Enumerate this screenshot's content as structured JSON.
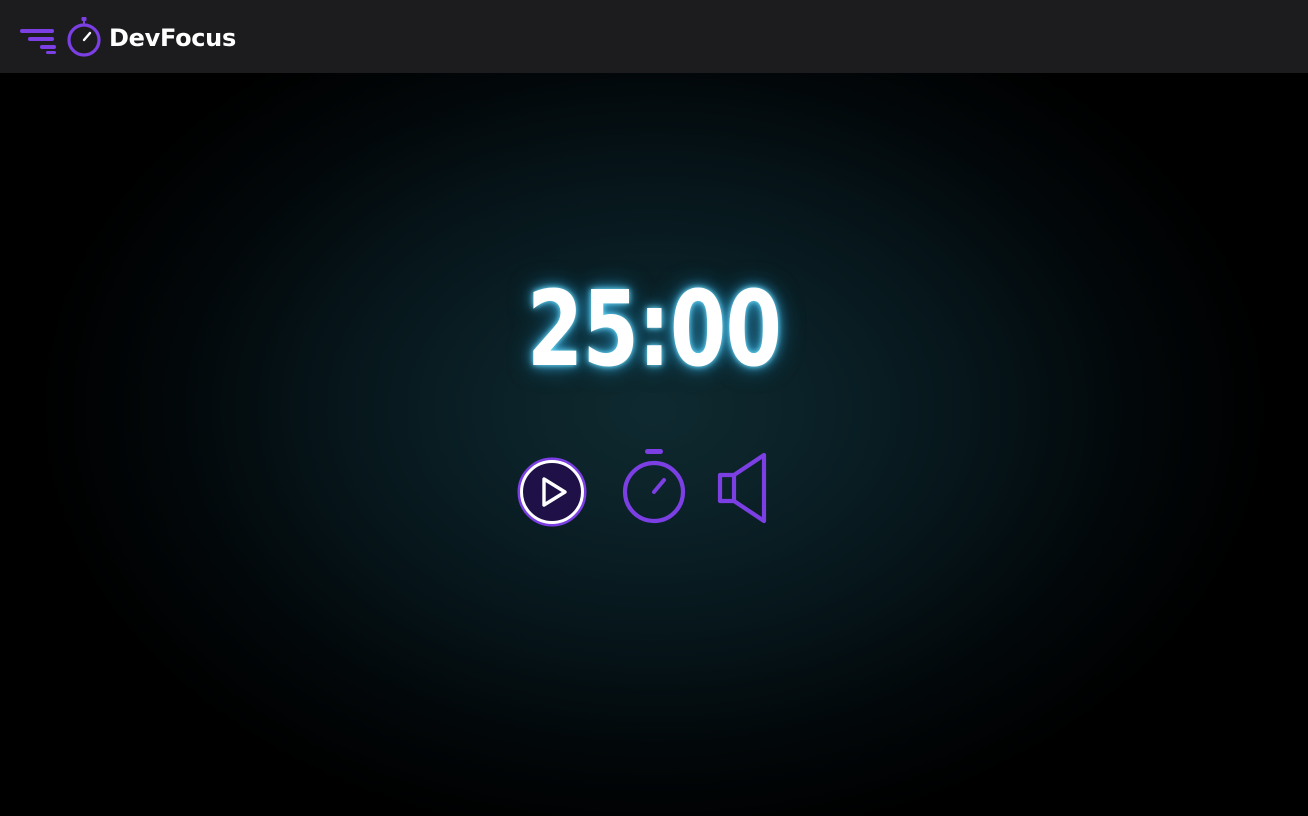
{
  "header": {
    "brand_name": "DevFocus",
    "logo_icon": "stopwatch-speed-icon"
  },
  "timer": {
    "display": "25:00"
  },
  "controls": {
    "items": [
      {
        "name": "play-button",
        "icon": "play-circle-icon"
      },
      {
        "name": "timer-button",
        "icon": "stopwatch-icon"
      },
      {
        "name": "sound-button",
        "icon": "speaker-icon"
      }
    ]
  },
  "colors": {
    "accent": "#7b3fe4",
    "timer_glow": "#46c8ff",
    "header_bg": "#1c1c1f",
    "background": "#000000"
  }
}
